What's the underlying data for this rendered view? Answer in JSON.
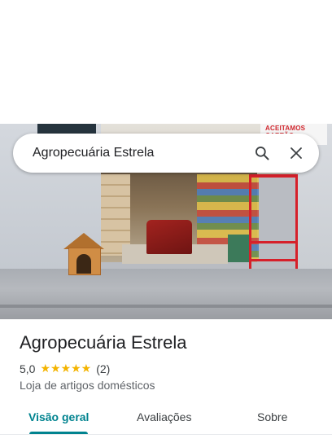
{
  "search": {
    "query": "Agropecuária Estrela",
    "search_icon": "search-icon",
    "close_icon": "close-icon"
  },
  "photo": {
    "sign_text": "ACEITAMOS CARTÃO"
  },
  "place": {
    "name": "Agropecuária Estrela",
    "rating": "5,0",
    "stars": "★★★★★",
    "review_count": "(2)",
    "category": "Loja de artigos domésticos"
  },
  "tabs": [
    {
      "label": "Visão geral",
      "active": true
    },
    {
      "label": "Avaliações",
      "active": false
    },
    {
      "label": "Sobre",
      "active": false
    }
  ],
  "colors": {
    "accent": "#00838f",
    "star": "#f4b400"
  }
}
